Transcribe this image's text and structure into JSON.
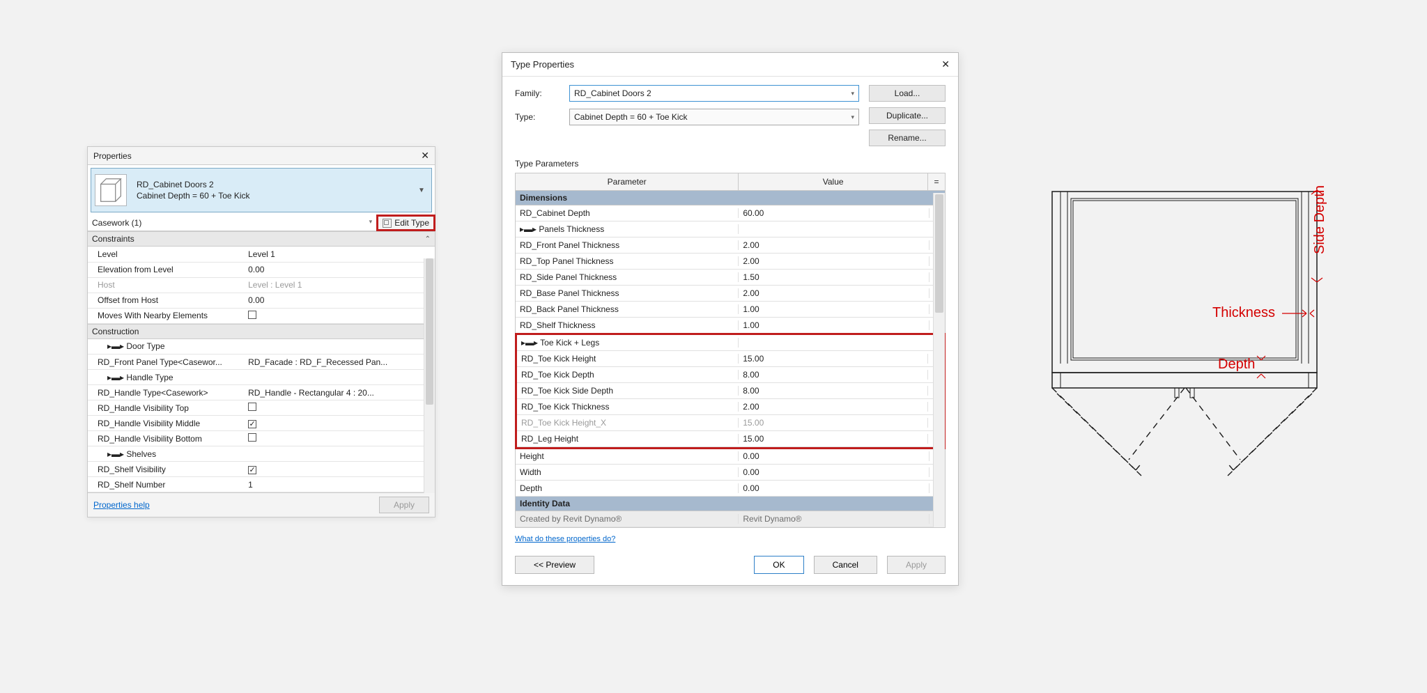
{
  "properties_panel": {
    "title": "Properties",
    "type_selector": {
      "family_name": "RD_Cabinet Doors 2",
      "type_name": "Cabinet Depth = 60 + Toe Kick"
    },
    "filter": "Casework (1)",
    "edit_type_label": "Edit Type",
    "sections": [
      {
        "name": "Constraints",
        "rows": [
          {
            "label": "Level",
            "value": "Level 1",
            "gray": false
          },
          {
            "label": "Elevation from Level",
            "value": "0.00",
            "gray": false
          },
          {
            "label": "Host",
            "value": "Level : Level 1",
            "gray": true
          },
          {
            "label": "Offset from Host",
            "value": "0.00",
            "gray": false
          },
          {
            "label": "Moves With Nearby Elements",
            "value": "",
            "checkbox": "off"
          }
        ]
      },
      {
        "name": "Construction",
        "rows": [
          {
            "label": "▸▬▸ Door Type",
            "value": "",
            "indent": true
          },
          {
            "label": "RD_Front Panel Type<Casewor...",
            "value": "RD_Facade : RD_F_Recessed Pan..."
          },
          {
            "label": "▸▬▸ Handle Type",
            "value": "",
            "indent": true
          },
          {
            "label": "RD_Handle Type<Casework>",
            "value": "RD_Handle - Rectangular 4 : 20..."
          },
          {
            "label": "RD_Handle Visibility Top",
            "value": "",
            "checkbox": "off"
          },
          {
            "label": "RD_Handle Visibility Middle",
            "value": "",
            "checkbox": "on"
          },
          {
            "label": "RD_Handle Visibility Bottom",
            "value": "",
            "checkbox": "off"
          },
          {
            "label": "▸▬▸ Shelves",
            "value": "",
            "indent": true
          },
          {
            "label": "RD_Shelf Visibility",
            "value": "",
            "checkbox": "on"
          },
          {
            "label": "RD_Shelf Number",
            "value": "1"
          }
        ]
      }
    ],
    "help_link": "Properties help",
    "apply_btn": "Apply"
  },
  "type_dialog": {
    "title": "Type Properties",
    "family_label": "Family:",
    "family_value": "RD_Cabinet Doors 2",
    "type_label": "Type:",
    "type_value": "Cabinet Depth = 60 + Toe Kick",
    "buttons": {
      "load": "Load...",
      "duplicate": "Duplicate...",
      "rename": "Rename..."
    },
    "params_label": "Type Parameters",
    "col_param": "Parameter",
    "col_value": "Value",
    "dimensions_header": "Dimensions",
    "rows_top": [
      {
        "p": "RD_Cabinet Depth",
        "v": "60.00"
      },
      {
        "p": "▸▬▸ Panels Thickness",
        "v": ""
      },
      {
        "p": "RD_Front Panel Thickness",
        "v": "2.00"
      },
      {
        "p": "RD_Top Panel Thickness",
        "v": "2.00"
      },
      {
        "p": "RD_Side Panel Thickness",
        "v": "1.50"
      },
      {
        "p": "RD_Base Panel Thickness",
        "v": "2.00"
      },
      {
        "p": "RD_Back Panel Thickness",
        "v": "1.00"
      },
      {
        "p": "RD_Shelf Thickness",
        "v": "1.00"
      }
    ],
    "rows_red": [
      {
        "p": "▸▬▸ Toe Kick + Legs",
        "v": ""
      },
      {
        "p": "RD_Toe Kick Height",
        "v": "15.00"
      },
      {
        "p": "RD_Toe Kick Depth",
        "v": "8.00"
      },
      {
        "p": "RD_Toe Kick Side Depth",
        "v": "8.00"
      },
      {
        "p": "RD_Toe Kick Thickness",
        "v": "2.00"
      },
      {
        "p": "RD_Toe Kick Height_X",
        "v": "15.00",
        "gray": true
      },
      {
        "p": "RD_Leg Height",
        "v": "15.00"
      }
    ],
    "rows_bottom": [
      {
        "p": "Height",
        "v": "0.00"
      },
      {
        "p": "Width",
        "v": "0.00"
      },
      {
        "p": "Depth",
        "v": "0.00"
      }
    ],
    "identity_header": "Identity Data",
    "identity_row": {
      "p": "Created by Revit Dynamo®",
      "v": "Revit Dynamo®"
    },
    "help_link": "What do these properties do?",
    "preview_btn": "<<  Preview",
    "ok": "OK",
    "cancel": "Cancel",
    "apply": "Apply"
  },
  "diagram": {
    "depth": "Depth",
    "thickness": "Thickness",
    "side_depth": "Side Depth"
  }
}
